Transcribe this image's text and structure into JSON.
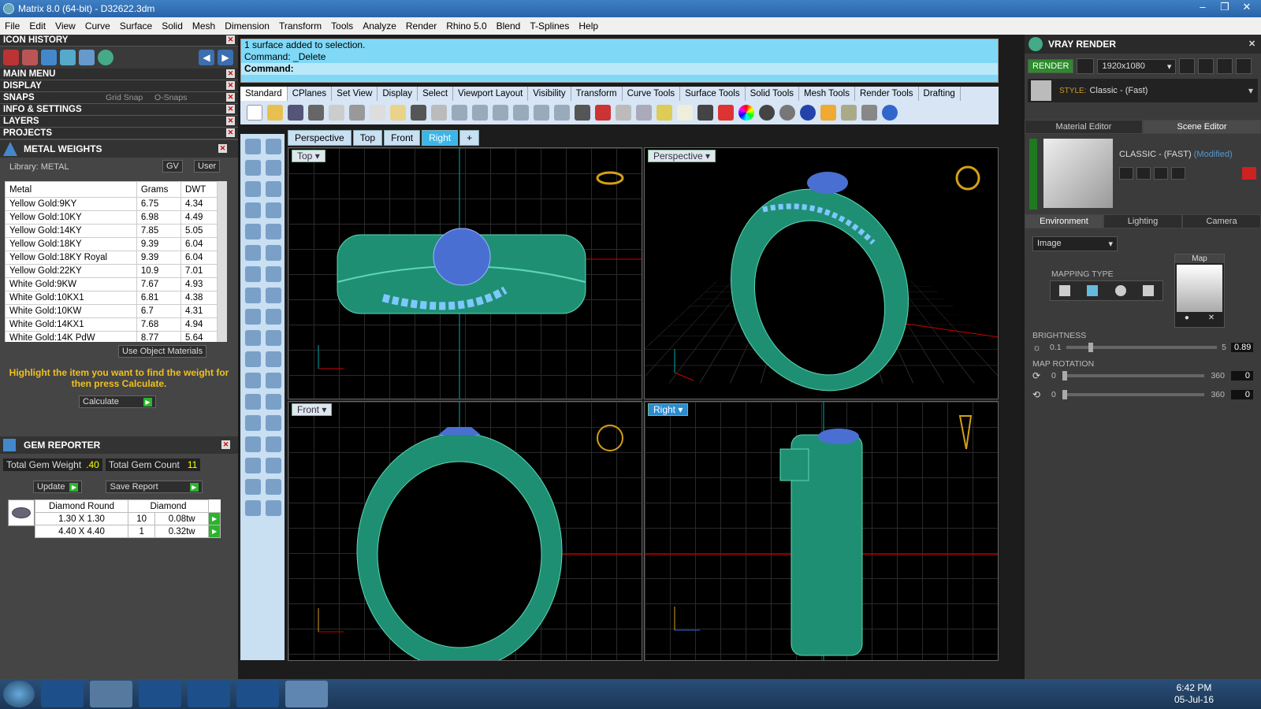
{
  "title": "Matrix 8.0 (64-bit) - D32622.3dm",
  "menu": [
    "File",
    "Edit",
    "View",
    "Curve",
    "Surface",
    "Solid",
    "Mesh",
    "Dimension",
    "Transform",
    "Tools",
    "Analyze",
    "Render",
    "Rhino 5.0",
    "Blend",
    "T-Splines",
    "Help"
  ],
  "left": {
    "icon_history": "ICON HISTORY",
    "main_menu": "MAIN MENU",
    "display": "DISPLAY",
    "snaps": "SNAPS",
    "grid_snap": "Grid Snap",
    "o_snaps": "O-Snaps",
    "info": "INFO & SETTINGS",
    "layers": "LAYERS",
    "projects": "PROJECTS",
    "metal_weights": "METAL WEIGHTS",
    "library": "Library: METAL",
    "gv": "GV",
    "user": "User",
    "cols": [
      "Metal",
      "Grams",
      "DWT"
    ],
    "rows": [
      [
        "Yellow Gold:9KY",
        "6.75",
        "4.34"
      ],
      [
        "Yellow Gold:10KY",
        "6.98",
        "4.49"
      ],
      [
        "Yellow Gold:14KY",
        "7.85",
        "5.05"
      ],
      [
        "Yellow Gold:18KY",
        "9.39",
        "6.04"
      ],
      [
        "Yellow Gold:18KY Royal",
        "9.39",
        "6.04"
      ],
      [
        "Yellow Gold:22KY",
        "10.9",
        "7.01"
      ],
      [
        "White Gold:9KW",
        "7.67",
        "4.93"
      ],
      [
        "White Gold:10KX1",
        "6.81",
        "4.38"
      ],
      [
        "White Gold:10KW",
        "6.7",
        "4.31"
      ],
      [
        "White Gold:14KX1",
        "7.68",
        "4.94"
      ],
      [
        "White Gold:14K PdW",
        "8.77",
        "5.64"
      ]
    ],
    "use_object_materials": "Use Object Materials",
    "hint": "Highlight the item you want to find the weight for then press Calculate.",
    "calculate": "Calculate",
    "gem_reporter": "GEM REPORTER",
    "total_gem_weight_label": "Total Gem Weight",
    "total_gem_weight": ".40",
    "total_gem_count_label": "Total Gem Count",
    "total_gem_count": "11",
    "update": "Update",
    "save_report": "Save Report",
    "gem_cols": [
      "Diamond Round",
      "Diamond"
    ],
    "gem_rows": [
      [
        "1.30 X 1.30",
        "10",
        "0.08tw"
      ],
      [
        "4.40 X 4.40",
        "1",
        "0.32tw"
      ]
    ]
  },
  "command": {
    "line1": "1 surface added to selection.",
    "line2": "Command: _Delete",
    "prompt": "Command:"
  },
  "toolbar_tabs": [
    "Standard",
    "CPlanes",
    "Set View",
    "Display",
    "Select",
    "Viewport Layout",
    "Visibility",
    "Transform",
    "Curve Tools",
    "Surface Tools",
    "Solid Tools",
    "Mesh Tools",
    "Render Tools",
    "Drafting"
  ],
  "viewport_tabs": [
    "Perspective",
    "Top",
    "Front",
    "Right"
  ],
  "viewports": {
    "top": "Top",
    "perspective": "Perspective",
    "front": "Front",
    "right": "Right"
  },
  "right": {
    "title": "VRAY RENDER",
    "render": "RENDER",
    "resolution": "1920x1080",
    "style_label": "STYLE:",
    "style": "Classic - (Fast)",
    "material_editor": "Material Editor",
    "scene_editor": "Scene Editor",
    "scene_name": "CLASSIC - (FAST)",
    "modified": "(Modified)",
    "env_tabs": [
      "Environment",
      "Lighting",
      "Camera"
    ],
    "image": "Image",
    "map": "Map",
    "mapping_type": "MAPPING TYPE",
    "brightness": "BRIGHTNESS",
    "brightness_min": "0.1",
    "brightness_max": "5",
    "brightness_val": "0.89",
    "map_rotation": "MAP ROTATION",
    "rot_min": "0",
    "rot_max": "360",
    "rot_val1": "0",
    "rot_val2": "0"
  },
  "clock": {
    "time": "6:42 PM",
    "date": "05-Jul-16"
  }
}
